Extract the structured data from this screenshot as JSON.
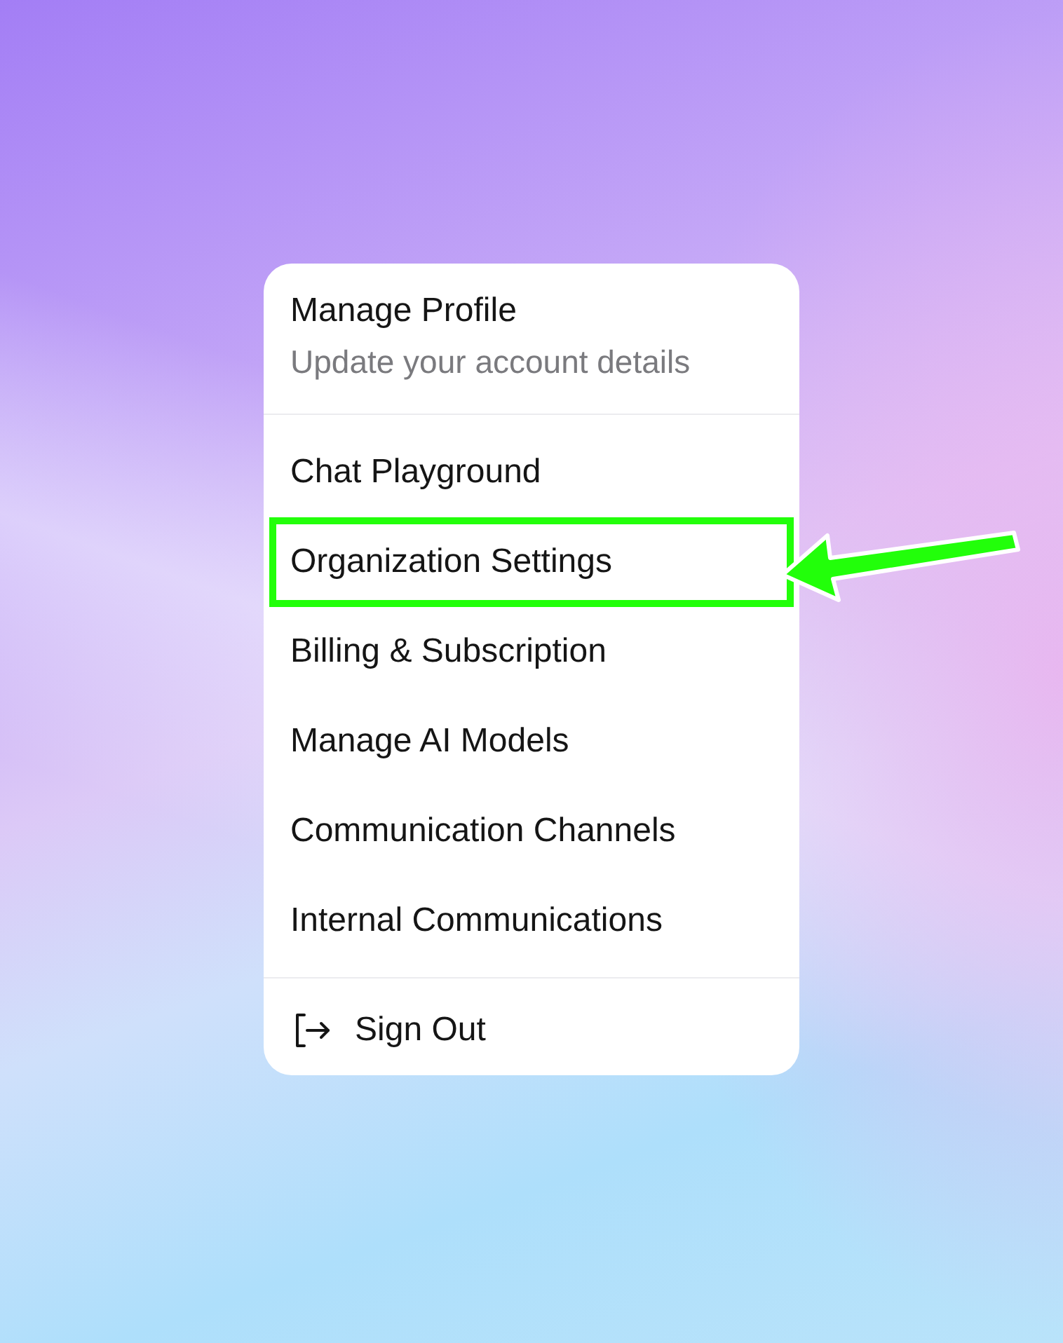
{
  "profile": {
    "title": "Manage Profile",
    "subtitle": "Update your account details"
  },
  "items": [
    {
      "label": "Chat Playground",
      "highlighted": false
    },
    {
      "label": "Organization Settings",
      "highlighted": true
    },
    {
      "label": "Billing & Subscription",
      "highlighted": false
    },
    {
      "label": "Manage AI Models",
      "highlighted": false
    },
    {
      "label": "Communication Channels",
      "highlighted": false
    },
    {
      "label": "Internal Communications",
      "highlighted": false
    }
  ],
  "sign_out": {
    "label": "Sign Out"
  }
}
